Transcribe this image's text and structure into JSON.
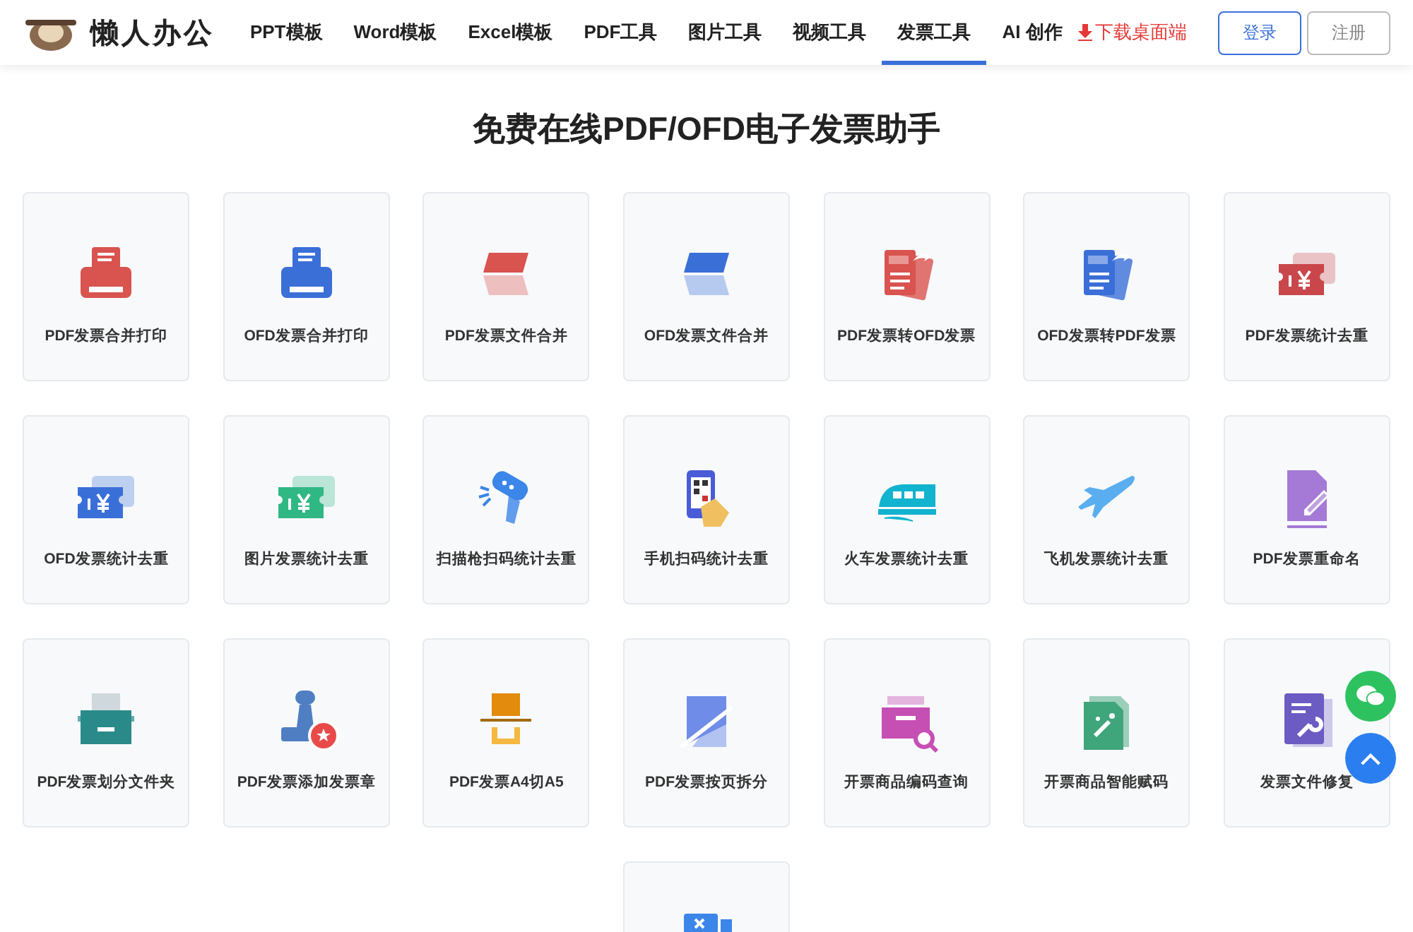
{
  "header": {
    "logo": "懒人办公",
    "nav": [
      {
        "label": "PPT模板",
        "selected": false
      },
      {
        "label": "Word模板",
        "selected": false
      },
      {
        "label": "Excel模板",
        "selected": false
      },
      {
        "label": "PDF工具",
        "selected": false
      },
      {
        "label": "图片工具",
        "selected": false
      },
      {
        "label": "视频工具",
        "selected": false
      },
      {
        "label": "发票工具",
        "selected": true
      },
      {
        "label": "AI 创作",
        "selected": false
      }
    ],
    "download": "下载桌面端",
    "login": "登录",
    "register": "注册"
  },
  "title": "免费在线PDF/OFD电子发票助手",
  "tools": [
    {
      "kind": "printer",
      "color": "#d9534f",
      "label": "PDF发票合并打印"
    },
    {
      "kind": "printer",
      "color": "#3b6fd8",
      "label": "OFD发票合并打印"
    },
    {
      "kind": "fold",
      "color": "#d9534f",
      "label": "PDF发票文件合并"
    },
    {
      "kind": "fold",
      "color": "#3b6fd8",
      "label": "OFD发票文件合并"
    },
    {
      "kind": "convert",
      "color": "#d9534f",
      "label": "PDF发票转OFD发票"
    },
    {
      "kind": "convert",
      "color": "#3b6fd8",
      "label": "OFD发票转PDF发票"
    },
    {
      "kind": "ticket",
      "color": "#c9474a",
      "label": "PDF发票统计去重"
    },
    {
      "kind": "ticket",
      "color": "#3b6fd8",
      "label": "OFD发票统计去重"
    },
    {
      "kind": "ticket",
      "color": "#2fb784",
      "label": "图片发票统计去重"
    },
    {
      "kind": "scanner",
      "color": "#3b86e8",
      "label": "扫描枪扫码统计去重"
    },
    {
      "kind": "phone",
      "color": "#4a5bd8",
      "label": "手机扫码统计去重"
    },
    {
      "kind": "train",
      "color": "#12b3cf",
      "label": "火车发票统计去重"
    },
    {
      "kind": "plane",
      "color": "#5aaeef",
      "label": "飞机发票统计去重"
    },
    {
      "kind": "rename",
      "color": "#a57ad6",
      "label": "PDF发票重命名"
    },
    {
      "kind": "folder",
      "color": "#2a8a8a",
      "label": "PDF发票划分文件夹"
    },
    {
      "kind": "stamp",
      "color": "#4f7fc2",
      "label": "PDF发票添加发票章"
    },
    {
      "kind": "cut",
      "color": "#e38b0c",
      "label": "PDF发票A4切A5"
    },
    {
      "kind": "split",
      "color": "#6f8de8",
      "label": "PDF发票按页拆分"
    },
    {
      "kind": "shop",
      "color": "#c64fb4",
      "label": "开票商品编码查询"
    },
    {
      "kind": "smart",
      "color": "#3fa57a",
      "label": "开票商品智能赋码"
    },
    {
      "kind": "repair",
      "color": "#6d5bc4",
      "label": "发票文件修复"
    },
    {
      "kind": "monitor",
      "color": "#3b86e8"
    }
  ]
}
